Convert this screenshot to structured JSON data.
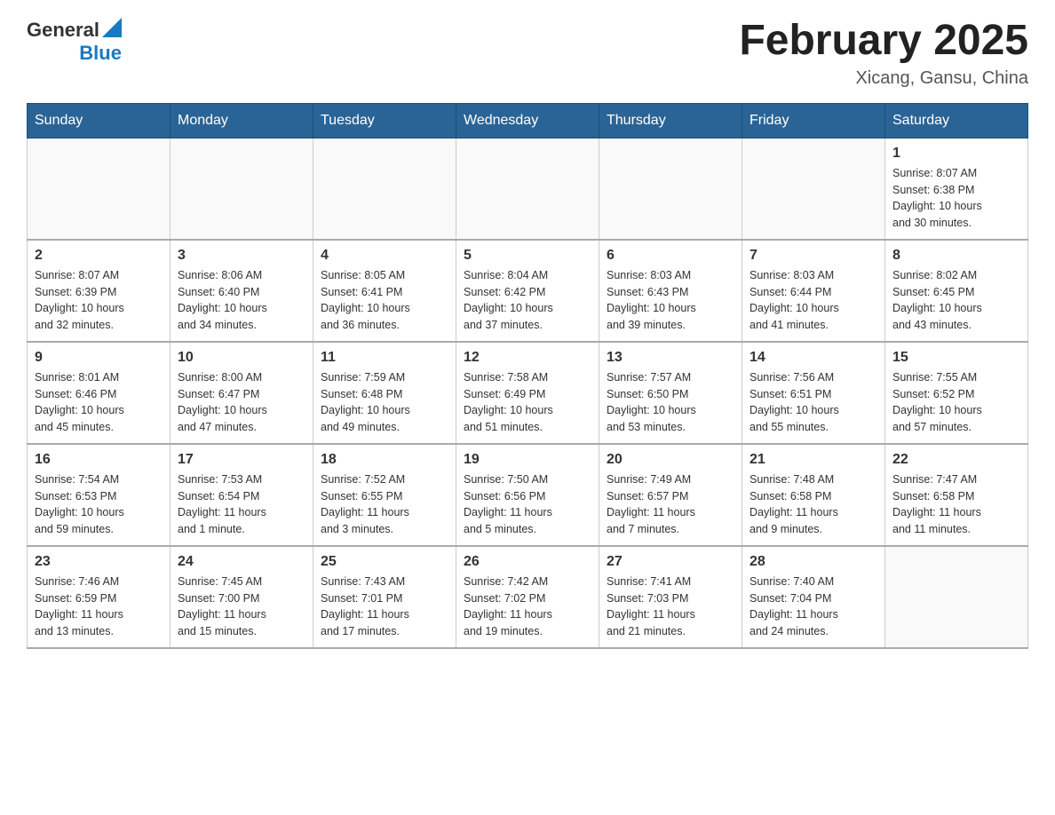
{
  "header": {
    "logo": {
      "general": "General",
      "blue": "Blue"
    },
    "title": "February 2025",
    "subtitle": "Xicang, Gansu, China"
  },
  "weekdays": [
    "Sunday",
    "Monday",
    "Tuesday",
    "Wednesday",
    "Thursday",
    "Friday",
    "Saturday"
  ],
  "weeks": [
    [
      {
        "day": "",
        "info": ""
      },
      {
        "day": "",
        "info": ""
      },
      {
        "day": "",
        "info": ""
      },
      {
        "day": "",
        "info": ""
      },
      {
        "day": "",
        "info": ""
      },
      {
        "day": "",
        "info": ""
      },
      {
        "day": "1",
        "info": "Sunrise: 8:07 AM\nSunset: 6:38 PM\nDaylight: 10 hours\nand 30 minutes."
      }
    ],
    [
      {
        "day": "2",
        "info": "Sunrise: 8:07 AM\nSunset: 6:39 PM\nDaylight: 10 hours\nand 32 minutes."
      },
      {
        "day": "3",
        "info": "Sunrise: 8:06 AM\nSunset: 6:40 PM\nDaylight: 10 hours\nand 34 minutes."
      },
      {
        "day": "4",
        "info": "Sunrise: 8:05 AM\nSunset: 6:41 PM\nDaylight: 10 hours\nand 36 minutes."
      },
      {
        "day": "5",
        "info": "Sunrise: 8:04 AM\nSunset: 6:42 PM\nDaylight: 10 hours\nand 37 minutes."
      },
      {
        "day": "6",
        "info": "Sunrise: 8:03 AM\nSunset: 6:43 PM\nDaylight: 10 hours\nand 39 minutes."
      },
      {
        "day": "7",
        "info": "Sunrise: 8:03 AM\nSunset: 6:44 PM\nDaylight: 10 hours\nand 41 minutes."
      },
      {
        "day": "8",
        "info": "Sunrise: 8:02 AM\nSunset: 6:45 PM\nDaylight: 10 hours\nand 43 minutes."
      }
    ],
    [
      {
        "day": "9",
        "info": "Sunrise: 8:01 AM\nSunset: 6:46 PM\nDaylight: 10 hours\nand 45 minutes."
      },
      {
        "day": "10",
        "info": "Sunrise: 8:00 AM\nSunset: 6:47 PM\nDaylight: 10 hours\nand 47 minutes."
      },
      {
        "day": "11",
        "info": "Sunrise: 7:59 AM\nSunset: 6:48 PM\nDaylight: 10 hours\nand 49 minutes."
      },
      {
        "day": "12",
        "info": "Sunrise: 7:58 AM\nSunset: 6:49 PM\nDaylight: 10 hours\nand 51 minutes."
      },
      {
        "day": "13",
        "info": "Sunrise: 7:57 AM\nSunset: 6:50 PM\nDaylight: 10 hours\nand 53 minutes."
      },
      {
        "day": "14",
        "info": "Sunrise: 7:56 AM\nSunset: 6:51 PM\nDaylight: 10 hours\nand 55 minutes."
      },
      {
        "day": "15",
        "info": "Sunrise: 7:55 AM\nSunset: 6:52 PM\nDaylight: 10 hours\nand 57 minutes."
      }
    ],
    [
      {
        "day": "16",
        "info": "Sunrise: 7:54 AM\nSunset: 6:53 PM\nDaylight: 10 hours\nand 59 minutes."
      },
      {
        "day": "17",
        "info": "Sunrise: 7:53 AM\nSunset: 6:54 PM\nDaylight: 11 hours\nand 1 minute."
      },
      {
        "day": "18",
        "info": "Sunrise: 7:52 AM\nSunset: 6:55 PM\nDaylight: 11 hours\nand 3 minutes."
      },
      {
        "day": "19",
        "info": "Sunrise: 7:50 AM\nSunset: 6:56 PM\nDaylight: 11 hours\nand 5 minutes."
      },
      {
        "day": "20",
        "info": "Sunrise: 7:49 AM\nSunset: 6:57 PM\nDaylight: 11 hours\nand 7 minutes."
      },
      {
        "day": "21",
        "info": "Sunrise: 7:48 AM\nSunset: 6:58 PM\nDaylight: 11 hours\nand 9 minutes."
      },
      {
        "day": "22",
        "info": "Sunrise: 7:47 AM\nSunset: 6:58 PM\nDaylight: 11 hours\nand 11 minutes."
      }
    ],
    [
      {
        "day": "23",
        "info": "Sunrise: 7:46 AM\nSunset: 6:59 PM\nDaylight: 11 hours\nand 13 minutes."
      },
      {
        "day": "24",
        "info": "Sunrise: 7:45 AM\nSunset: 7:00 PM\nDaylight: 11 hours\nand 15 minutes."
      },
      {
        "day": "25",
        "info": "Sunrise: 7:43 AM\nSunset: 7:01 PM\nDaylight: 11 hours\nand 17 minutes."
      },
      {
        "day": "26",
        "info": "Sunrise: 7:42 AM\nSunset: 7:02 PM\nDaylight: 11 hours\nand 19 minutes."
      },
      {
        "day": "27",
        "info": "Sunrise: 7:41 AM\nSunset: 7:03 PM\nDaylight: 11 hours\nand 21 minutes."
      },
      {
        "day": "28",
        "info": "Sunrise: 7:40 AM\nSunset: 7:04 PM\nDaylight: 11 hours\nand 24 minutes."
      },
      {
        "day": "",
        "info": ""
      }
    ]
  ]
}
